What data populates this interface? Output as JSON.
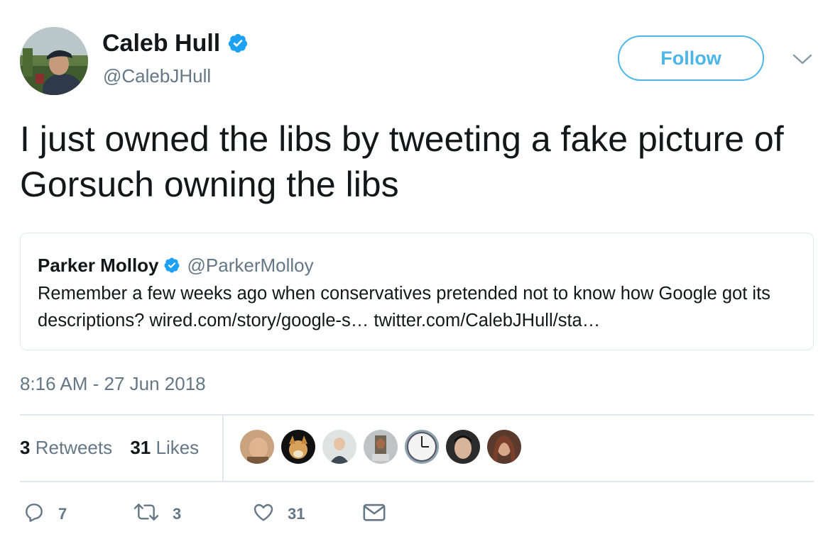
{
  "author": {
    "name": "Caleb Hull",
    "handle": "@CalebJHull",
    "verified_icon": "verified-badge-icon"
  },
  "follow_label": "Follow",
  "tweet_text": "I just owned the libs by tweeting a fake picture of Gorsuch owning the libs",
  "quoted": {
    "name": "Parker Molloy",
    "handle": "@ParkerMolloy",
    "text": "Remember a few weeks ago when conservatives pretended not to know how Google got its descriptions? wired.com/story/google-s… twitter.com/CalebJHull/sta…"
  },
  "timestamp": "8:16 AM - 27 Jun 2018",
  "stats": {
    "retweets_count": "3",
    "retweets_label": "Retweets",
    "likes_count": "31",
    "likes_label": "Likes"
  },
  "actions": {
    "reply_count": "7",
    "retweet_count": "3",
    "like_count": "31"
  },
  "colors": {
    "accent": "#1da1f2",
    "follow": "#4cb6e8",
    "secondary_text": "#657786",
    "border": "#e1e8ed"
  }
}
